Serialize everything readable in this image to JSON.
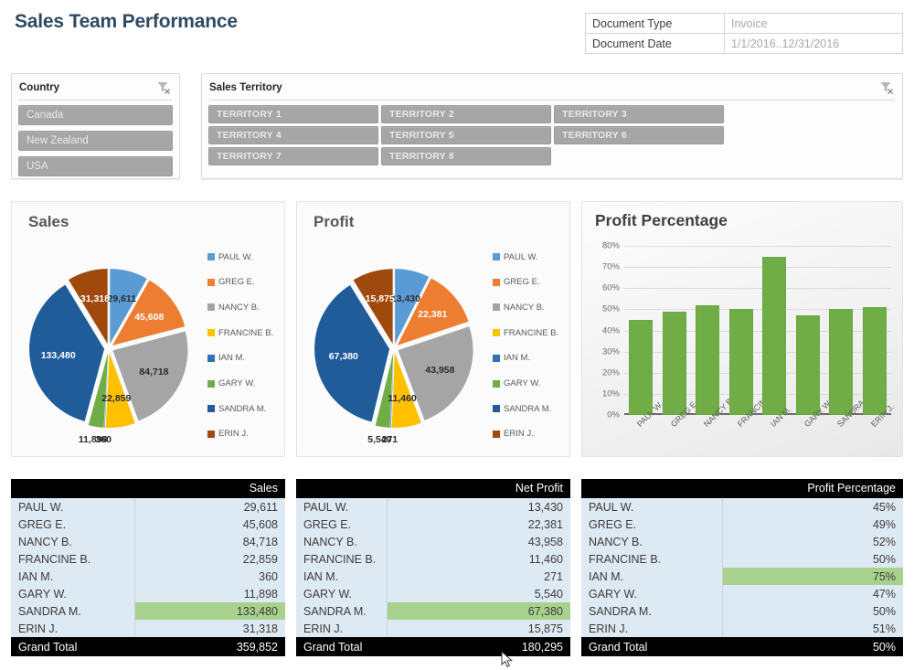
{
  "header": {
    "title": "Sales Team Performance",
    "doc_info": [
      {
        "label": "Document Type",
        "value": "Invoice"
      },
      {
        "label": "Document Date",
        "value": "1/1/2016..12/31/2016"
      }
    ]
  },
  "slicers": {
    "country": {
      "title": "Country",
      "clear_icon": "clear-filter-icon",
      "items": [
        "Canada",
        "New Zealand",
        "USA"
      ]
    },
    "territory": {
      "title": "Sales Territory",
      "clear_icon": "clear-filter-icon",
      "items": [
        "TERRITORY 1",
        "TERRITORY 2",
        "TERRITORY 3",
        "TERRITORY 4",
        "TERRITORY 5",
        "TERRITORY 6",
        "TERRITORY 7",
        "TERRITORY 8"
      ]
    }
  },
  "people": [
    "PAUL W.",
    "GREG E.",
    "NANCY B.",
    "FRANCINE B.",
    "IAN M.",
    "GARY W.",
    "SANDRA M.",
    "ERIN J."
  ],
  "series_colors": [
    "#5b9bd5",
    "#ed7d31",
    "#a5a5a5",
    "#ffc000",
    "#2e75b6",
    "#70ad47",
    "#1f5c99",
    "#a0490d"
  ],
  "accent_green": "#70ad47",
  "highlight_green": "#a9d18e",
  "chart_data": [
    {
      "type": "pie",
      "title": "Sales",
      "categories": [
        "PAUL W.",
        "GREG E.",
        "NANCY B.",
        "FRANCINE B.",
        "IAN M.",
        "GARY W.",
        "SANDRA M.",
        "ERIN J."
      ],
      "values": [
        29611,
        45608,
        84718,
        22859,
        360,
        11898,
        133480,
        31318
      ],
      "labels": [
        "29,611",
        "45,608",
        "84,718",
        "22,859",
        "360",
        "11,898",
        "133,480",
        "31,318"
      ],
      "colors": [
        "#5b9bd5",
        "#ed7d31",
        "#a5a5a5",
        "#ffc000",
        "#2e75b6",
        "#70ad47",
        "#1f5c99",
        "#a0490d"
      ],
      "total": 359852,
      "legend_position": "right",
      "exploded": true
    },
    {
      "type": "pie",
      "title": "Profit",
      "categories": [
        "PAUL W.",
        "GREG E.",
        "NANCY B.",
        "FRANCINE B.",
        "IAN M.",
        "GARY W.",
        "SANDRA M.",
        "ERIN J."
      ],
      "values": [
        13430,
        22381,
        43958,
        11460,
        271,
        5540,
        67380,
        15875
      ],
      "labels": [
        "13,430",
        "22,381",
        "43,958",
        "11,460",
        "271",
        "5,540",
        "67,380",
        "15,875"
      ],
      "colors": [
        "#5b9bd5",
        "#ed7d31",
        "#a5a5a5",
        "#ffc000",
        "#2e75b6",
        "#70ad47",
        "#1f5c99",
        "#a0490d"
      ],
      "total": 180295,
      "legend_position": "right",
      "exploded": true
    },
    {
      "type": "bar",
      "title": "Profit Percentage",
      "categories": [
        "PAUL W.",
        "GREG E.",
        "NANCY B.",
        "FRANCINE B.",
        "IAN M.",
        "GARY W.",
        "SANDRA M.",
        "ERIN J."
      ],
      "values": [
        45,
        49,
        52,
        50,
        75,
        47,
        50,
        51
      ],
      "ylim": [
        0,
        80
      ],
      "yticks": [
        "0%",
        "10%",
        "20%",
        "30%",
        "40%",
        "50%",
        "60%",
        "70%",
        "80%"
      ],
      "ytick_values": [
        0,
        10,
        20,
        30,
        40,
        50,
        60,
        70,
        80
      ],
      "xlabel": "",
      "ylabel": "",
      "grid": true,
      "bar_color": "#70ad47",
      "legend_position": "none"
    }
  ],
  "tables": {
    "sales": {
      "value_header": "Sales",
      "rows": [
        {
          "name": "PAUL W.",
          "value": "29,611",
          "highlight": false
        },
        {
          "name": "GREG E.",
          "value": "45,608",
          "highlight": false
        },
        {
          "name": "NANCY B.",
          "value": "84,718",
          "highlight": false
        },
        {
          "name": "FRANCINE B.",
          "value": "22,859",
          "highlight": false
        },
        {
          "name": "IAN M.",
          "value": "360",
          "highlight": false
        },
        {
          "name": "GARY W.",
          "value": "11,898",
          "highlight": false
        },
        {
          "name": "SANDRA M.",
          "value": "133,480",
          "highlight": true
        },
        {
          "name": "ERIN J.",
          "value": "31,318",
          "highlight": false
        }
      ],
      "total_label": "Grand Total",
      "total_value": "359,852"
    },
    "profit": {
      "value_header": "Net Profit",
      "rows": [
        {
          "name": "PAUL W.",
          "value": "13,430",
          "highlight": false
        },
        {
          "name": "GREG E.",
          "value": "22,381",
          "highlight": false
        },
        {
          "name": "NANCY B.",
          "value": "43,958",
          "highlight": false
        },
        {
          "name": "FRANCINE B.",
          "value": "11,460",
          "highlight": false
        },
        {
          "name": "IAN M.",
          "value": "271",
          "highlight": false
        },
        {
          "name": "GARY W.",
          "value": "5,540",
          "highlight": false
        },
        {
          "name": "SANDRA M.",
          "value": "67,380",
          "highlight": true
        },
        {
          "name": "ERIN J.",
          "value": "15,875",
          "highlight": false
        }
      ],
      "total_label": "Grand Total",
      "total_value": "180,295"
    },
    "percentage": {
      "value_header": "Profit Percentage",
      "rows": [
        {
          "name": "PAUL W.",
          "value": "45%",
          "highlight": false
        },
        {
          "name": "GREG E.",
          "value": "49%",
          "highlight": false
        },
        {
          "name": "NANCY B.",
          "value": "52%",
          "highlight": false
        },
        {
          "name": "FRANCINE B.",
          "value": "50%",
          "highlight": false
        },
        {
          "name": "IAN M.",
          "value": "75%",
          "highlight": true
        },
        {
          "name": "GARY W.",
          "value": "47%",
          "highlight": false
        },
        {
          "name": "SANDRA M.",
          "value": "50%",
          "highlight": false
        },
        {
          "name": "ERIN J.",
          "value": "51%",
          "highlight": false
        }
      ],
      "total_label": "Grand Total",
      "total_value": "50%"
    }
  }
}
